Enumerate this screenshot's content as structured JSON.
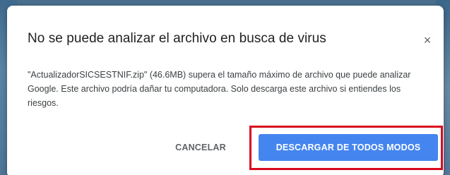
{
  "dialog": {
    "title": "No se puede analizar el archivo en busca de virus",
    "close_icon": "×",
    "message": "\"ActualizadorSICSESTNIF.zip\" (46.6MB) supera el tamaño máximo de archivo que puede analizar Google. Este archivo podría dañar tu computadora. Solo descarga este archivo si entiendes los riesgos.",
    "cancel_label": "CANCELAR",
    "download_label": "DESCARGAR DE TODOS MODOS"
  },
  "colors": {
    "primary_button": "#4485ef",
    "highlight_border": "#d9091e"
  }
}
